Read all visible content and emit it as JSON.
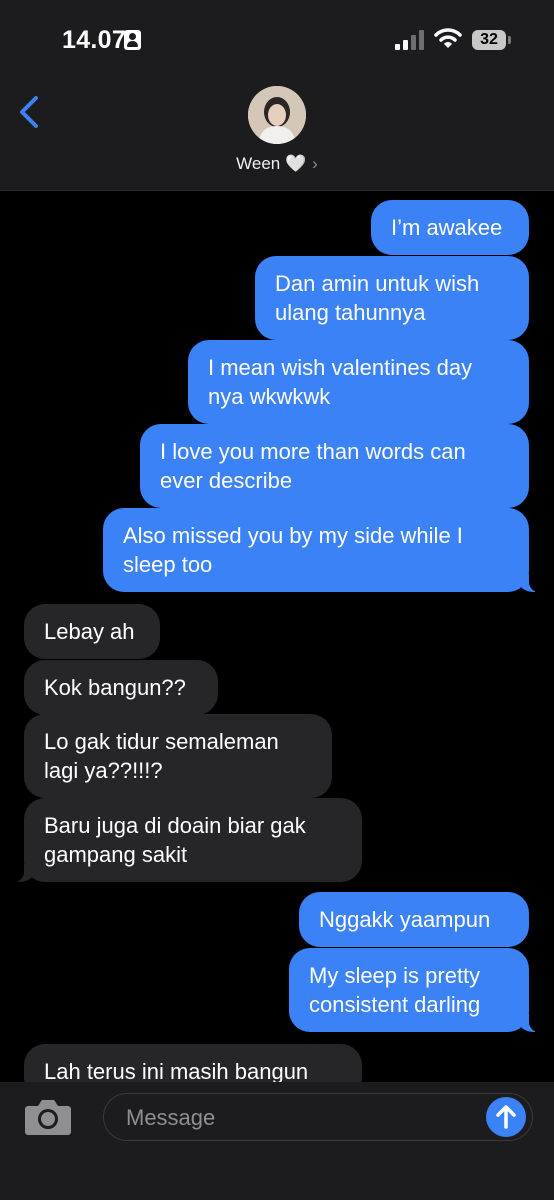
{
  "status_bar": {
    "time": "14.07",
    "battery": "32",
    "icons": [
      "id-card-icon",
      "signal-icon",
      "wifi-icon",
      "battery-icon"
    ]
  },
  "header": {
    "contact_name": "Ween 🤍",
    "chevron": "›",
    "icons": [
      "back-chevron-icon",
      "contact-avatar"
    ]
  },
  "messages": [
    {
      "direction": "out",
      "lines": [
        "I’m awakee"
      ]
    },
    {
      "direction": "out",
      "lines": [
        "Dan amin untuk wish",
        "ulang tahunnya"
      ]
    },
    {
      "direction": "out",
      "lines": [
        "I mean wish valentines day",
        "nya wkwkwk"
      ]
    },
    {
      "direction": "out",
      "lines": [
        "I love you more than words can",
        "ever describe"
      ]
    },
    {
      "direction": "out",
      "lines": [
        "Also missed you by my side while I",
        "sleep too"
      ]
    },
    {
      "direction": "in",
      "lines": [
        "Lebay ah"
      ]
    },
    {
      "direction": "in",
      "lines": [
        "Kok bangun??"
      ]
    },
    {
      "direction": "in",
      "lines": [
        "Lo gak tidur semaleman",
        "lagi ya??!!!?"
      ]
    },
    {
      "direction": "in",
      "lines": [
        "Baru juga di doain biar gak",
        "gampang sakit"
      ]
    },
    {
      "direction": "out",
      "lines": [
        "Nggakk yaampun"
      ]
    },
    {
      "direction": "out",
      "lines": [
        "My sleep is pretty",
        "consistent darling"
      ]
    },
    {
      "direction": "in",
      "lines": [
        "Lah terus ini masih bangun"
      ]
    }
  ],
  "composer": {
    "placeholder": "Message",
    "icons": [
      "camera-icon",
      "send-arrow-icon"
    ]
  },
  "colors": {
    "outgoing_bubble": "#3b82f6",
    "incoming_bubble": "#262628",
    "background": "#000000",
    "bars": "#1c1c1e"
  }
}
